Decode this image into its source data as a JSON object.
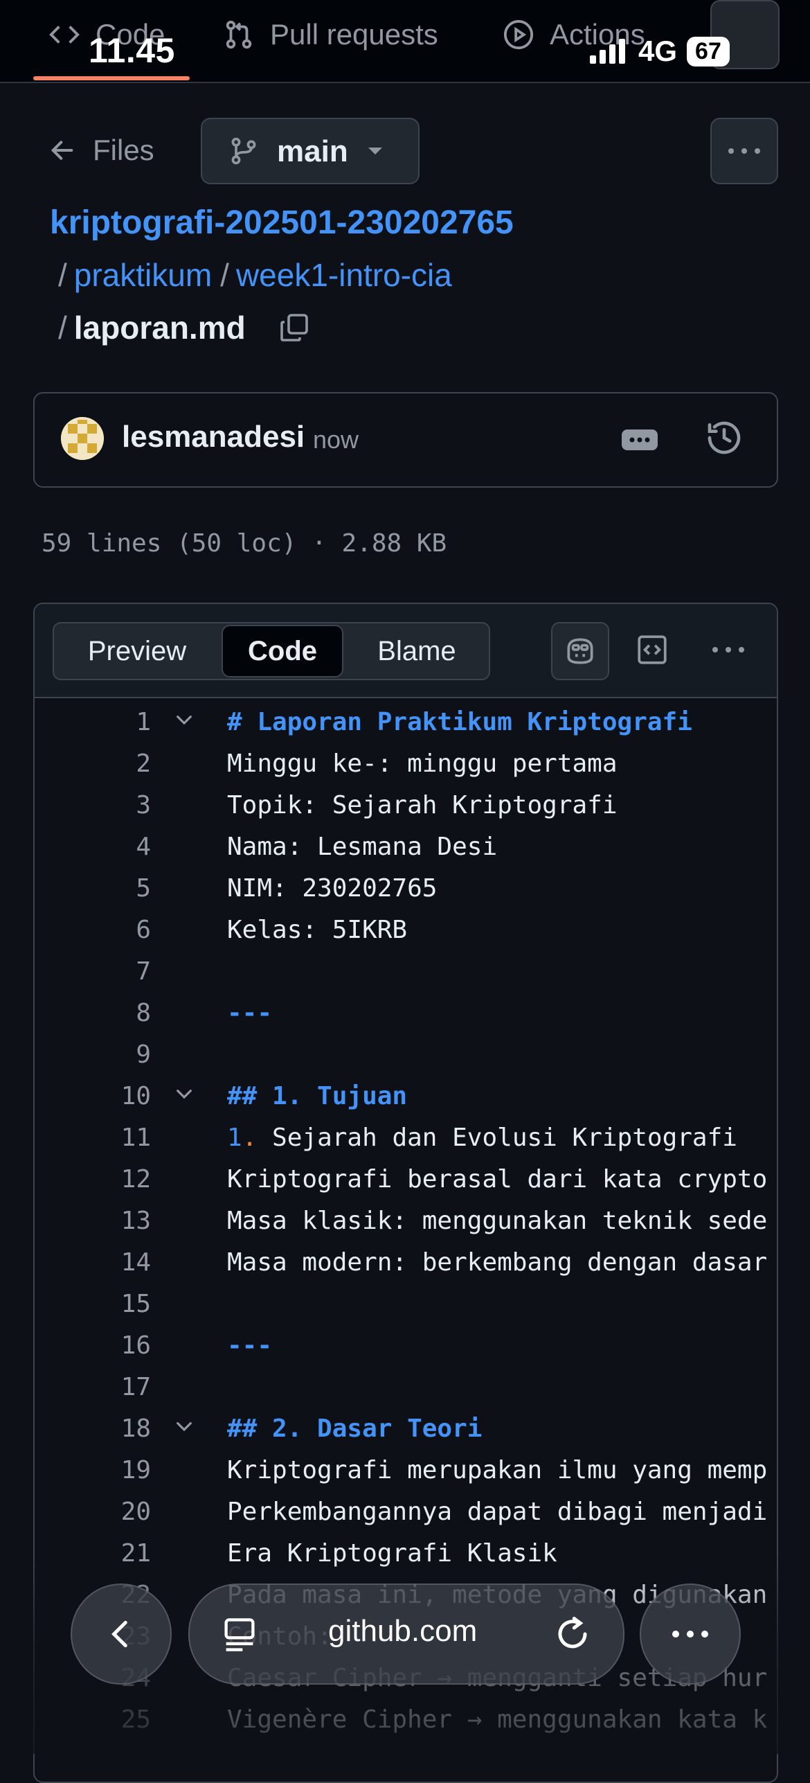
{
  "top_tabs": [
    {
      "label": "Code",
      "icon": "code-icon"
    },
    {
      "label": "Pull requests",
      "icon": "pull-request-icon"
    },
    {
      "label": "Actions",
      "icon": "play-icon"
    }
  ],
  "status": {
    "time": "11.45",
    "network": "4G",
    "battery": "67"
  },
  "nav": {
    "files_label": "Files",
    "branch": "main"
  },
  "breadcrumb": {
    "repo": "kriptografi-202501-230202765",
    "folder1": "praktikum",
    "folder2": "week1-intro-cia",
    "file": "laporan.md",
    "separator": "/"
  },
  "commit": {
    "author": "lesmanadesi",
    "time": "now"
  },
  "file_meta": "59 lines (50 loc) · 2.88 KB",
  "view_tabs": {
    "preview": "Preview",
    "code": "Code",
    "blame": "Blame",
    "active": "Code"
  },
  "code_lines": [
    {
      "n": "1",
      "text": "# Laporan Praktikum Kriptografi",
      "kind": "heading",
      "fold": true
    },
    {
      "n": "2",
      "text": "Minggu ke-: minggu pertama",
      "kind": "plain"
    },
    {
      "n": "3",
      "text": "Topik: Sejarah Kriptografi",
      "kind": "plain"
    },
    {
      "n": "4",
      "text": "Nama: Lesmana Desi",
      "kind": "plain"
    },
    {
      "n": "5",
      "text": "NIM: 230202765",
      "kind": "plain"
    },
    {
      "n": "6",
      "text": "Kelas: 5IKRB",
      "kind": "plain"
    },
    {
      "n": "7",
      "text": "",
      "kind": "plain"
    },
    {
      "n": "8",
      "text": "---",
      "kind": "hr"
    },
    {
      "n": "9",
      "text": "",
      "kind": "plain"
    },
    {
      "n": "10",
      "text": "## 1. Tujuan",
      "kind": "heading",
      "fold": true
    },
    {
      "n": "11",
      "text": "1. Sejarah dan Evolusi Kriptografi",
      "kind": "list"
    },
    {
      "n": "12",
      "text": "Kriptografi berasal dari kata crypto",
      "kind": "plain"
    },
    {
      "n": "13",
      "text": "Masa klasik: menggunakan teknik sede",
      "kind": "plain"
    },
    {
      "n": "14",
      "text": "Masa modern: berkembang dengan dasar",
      "kind": "plain"
    },
    {
      "n": "15",
      "text": "",
      "kind": "plain"
    },
    {
      "n": "16",
      "text": "---",
      "kind": "hr"
    },
    {
      "n": "17",
      "text": "",
      "kind": "plain"
    },
    {
      "n": "18",
      "text": "## 2. Dasar Teori",
      "kind": "heading",
      "fold": true
    },
    {
      "n": "19",
      "text": "Kriptografi merupakan ilmu yang memp",
      "kind": "plain"
    },
    {
      "n": "20",
      "text": "Perkembangannya dapat dibagi menjadi",
      "kind": "plain"
    },
    {
      "n": "21",
      "text": "Era Kriptografi Klasik",
      "kind": "plain"
    },
    {
      "n": "22",
      "text": "Pada masa ini, metode yang digunakan",
      "kind": "plain"
    },
    {
      "n": "23",
      "text": "Contoh:",
      "kind": "plain"
    },
    {
      "n": "24",
      "text": "Caesar Cipher → mengganti setiap hur",
      "kind": "plain"
    },
    {
      "n": "25",
      "text": "Vigenère Cipher → menggunakan kata k",
      "kind": "plain"
    }
  ],
  "browser": {
    "url": "github.com"
  },
  "colors": {
    "accent_link": "#4493f8",
    "tab_underline": "#f78166",
    "background": "#0d1117"
  }
}
